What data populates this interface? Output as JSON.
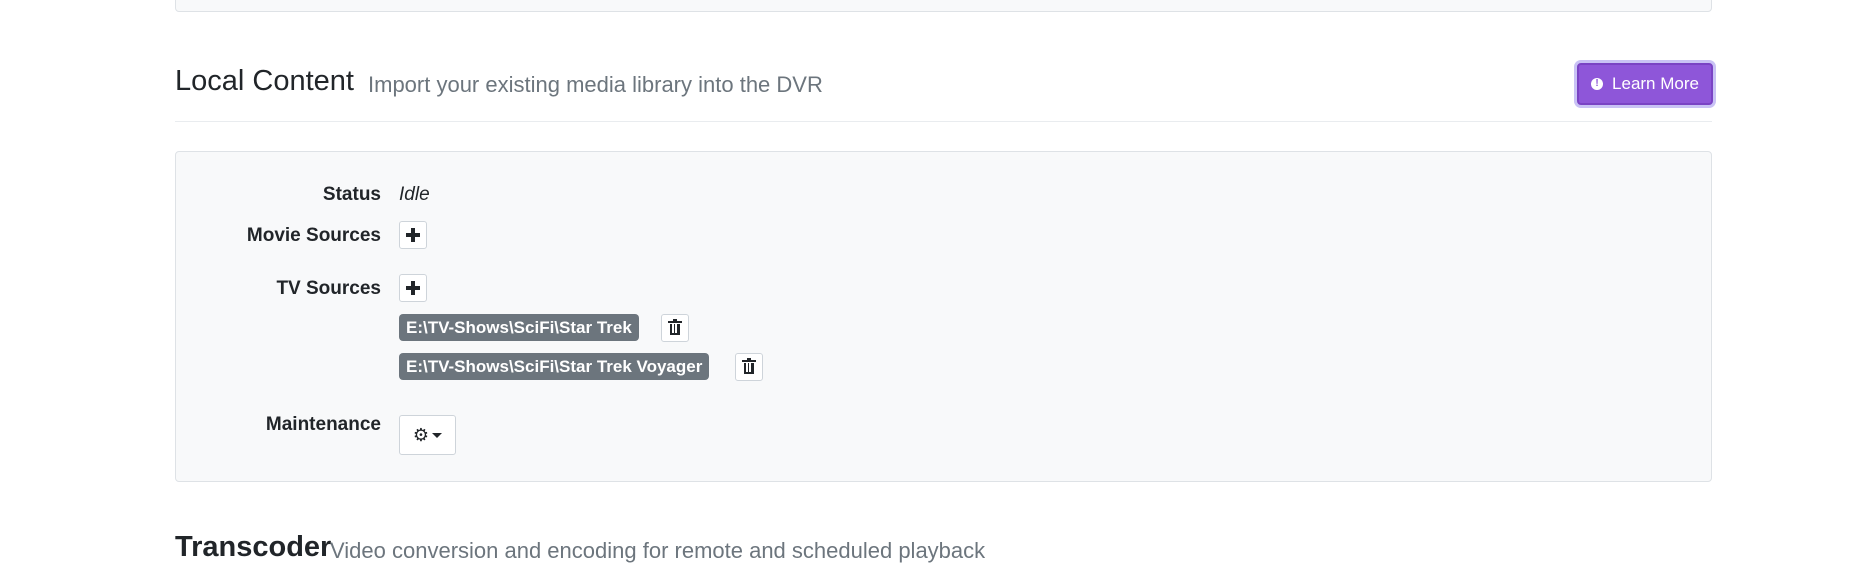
{
  "local_content": {
    "title": "Local Content",
    "subtitle": "Import your existing media library into the DVR",
    "learn_more_label": "Learn More",
    "status_label": "Status",
    "status_value": "Idle",
    "movie_sources_label": "Movie Sources",
    "tv_sources_label": "TV Sources",
    "tv_sources": [
      "E:\\TV-Shows\\SciFi\\Star Trek",
      "E:\\TV-Shows\\SciFi\\Star Trek Voyager"
    ],
    "maintenance_label": "Maintenance"
  },
  "next_section": {
    "title": "Transcoder",
    "subtitle": "Video conversion and encoding for remote and scheduled playback"
  },
  "icons": {
    "learn_more": "info-circle-icon",
    "add": "plus-icon",
    "delete": "trash-icon",
    "maintenance": "gear-icon",
    "dropdown": "caret-down-icon"
  },
  "colors": {
    "accent": "#8e56d9",
    "badge": "#6c757d",
    "card_bg": "#f8f9fa",
    "subtitle": "#6c757d"
  }
}
